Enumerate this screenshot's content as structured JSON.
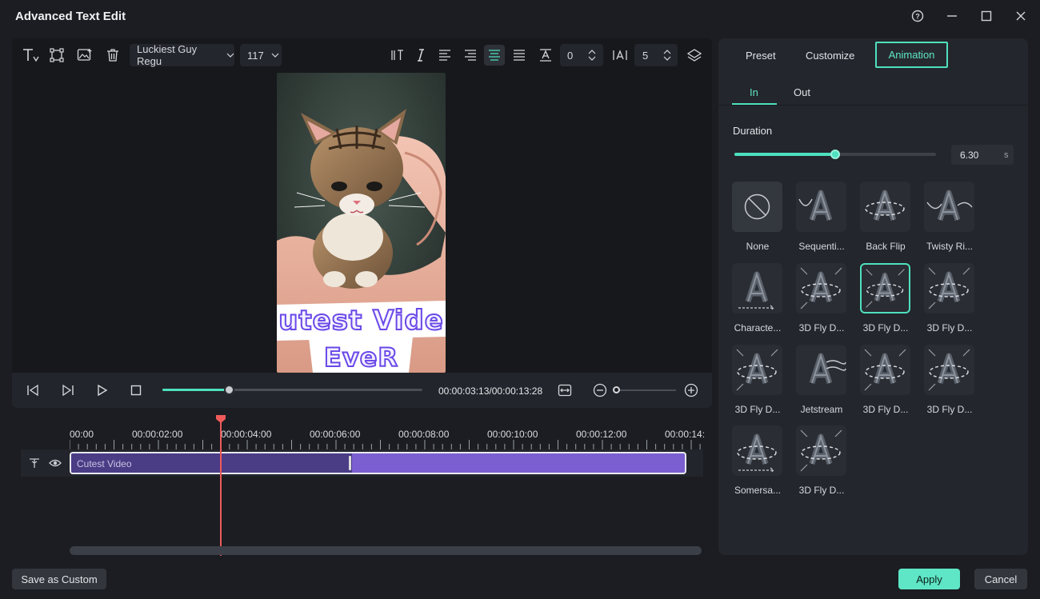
{
  "window": {
    "title": "Advanced Text Edit",
    "controls": [
      "help-icon",
      "minimize-icon",
      "maximize-icon",
      "close-icon"
    ]
  },
  "toolbar": {
    "font_family": "Luckiest Guy Regu",
    "font_size": "117",
    "line_spacing": "0",
    "char_spacing": "5",
    "icons": [
      "text-icon",
      "transform-icon",
      "image-icon",
      "trash-icon",
      "vertical-text-icon",
      "italic-icon",
      "align-left-icon",
      "align-right-icon",
      "align-center-icon",
      "justify-icon",
      "line-spacing-icon",
      "char-spacing-icon",
      "layers-icon"
    ]
  },
  "preview": {
    "subject": "kitten-in-hands",
    "overlay_line1": "utest Vide",
    "overlay_line2": "EveR"
  },
  "playback": {
    "timecode": "00:00:03:13/00:00:13:28",
    "progress": 0.26,
    "zoom": 0.0
  },
  "timeline": {
    "ruler": [
      "00:00",
      "00:00:02:00",
      "00:00:04:00",
      "00:00:06:00",
      "00:00:08:00",
      "00:00:10:00",
      "00:00:12:00",
      "00:00:14:"
    ],
    "clip_label": "Cutest Video",
    "playhead_time": "00:00:03:13"
  },
  "right_panel": {
    "tabs": [
      "Preset",
      "Customize",
      "Animation"
    ],
    "active_tab": "Animation",
    "subtabs": [
      "In",
      "Out"
    ],
    "active_subtab": "In",
    "duration_label": "Duration",
    "duration_value": "6.30",
    "duration_unit": "s",
    "duration_fraction": 0.5,
    "animations": [
      {
        "label": "None",
        "icon": "none-icon"
      },
      {
        "label": "Sequenti...",
        "icon": "sequential-icon"
      },
      {
        "label": "Back Flip",
        "icon": "back-flip-icon"
      },
      {
        "label": "Twisty Ri...",
        "icon": "twisty-icon"
      },
      {
        "label": "Characte...",
        "icon": "character-icon"
      },
      {
        "label": "3D Fly D...",
        "icon": "fly-icon"
      },
      {
        "label": "3D Fly D...",
        "icon": "fly-icon",
        "selected": true
      },
      {
        "label": "3D Fly D...",
        "icon": "fly-icon"
      },
      {
        "label": "3D Fly D...",
        "icon": "fly-icon"
      },
      {
        "label": "Jetstream",
        "icon": "jetstream-icon"
      },
      {
        "label": "3D Fly D...",
        "icon": "fly-icon"
      },
      {
        "label": "3D Fly D...",
        "icon": "fly-icon"
      },
      {
        "label": "Somersa...",
        "icon": "somersault-icon"
      },
      {
        "label": "3D Fly D...",
        "icon": "fly-icon"
      }
    ]
  },
  "buttons": {
    "save_custom": "Save as Custom",
    "apply": "Apply",
    "cancel": "Cancel"
  },
  "colors": {
    "accent": "#4ee0bf",
    "clip": "#7b5fd0",
    "playhead": "#f05a5a"
  }
}
